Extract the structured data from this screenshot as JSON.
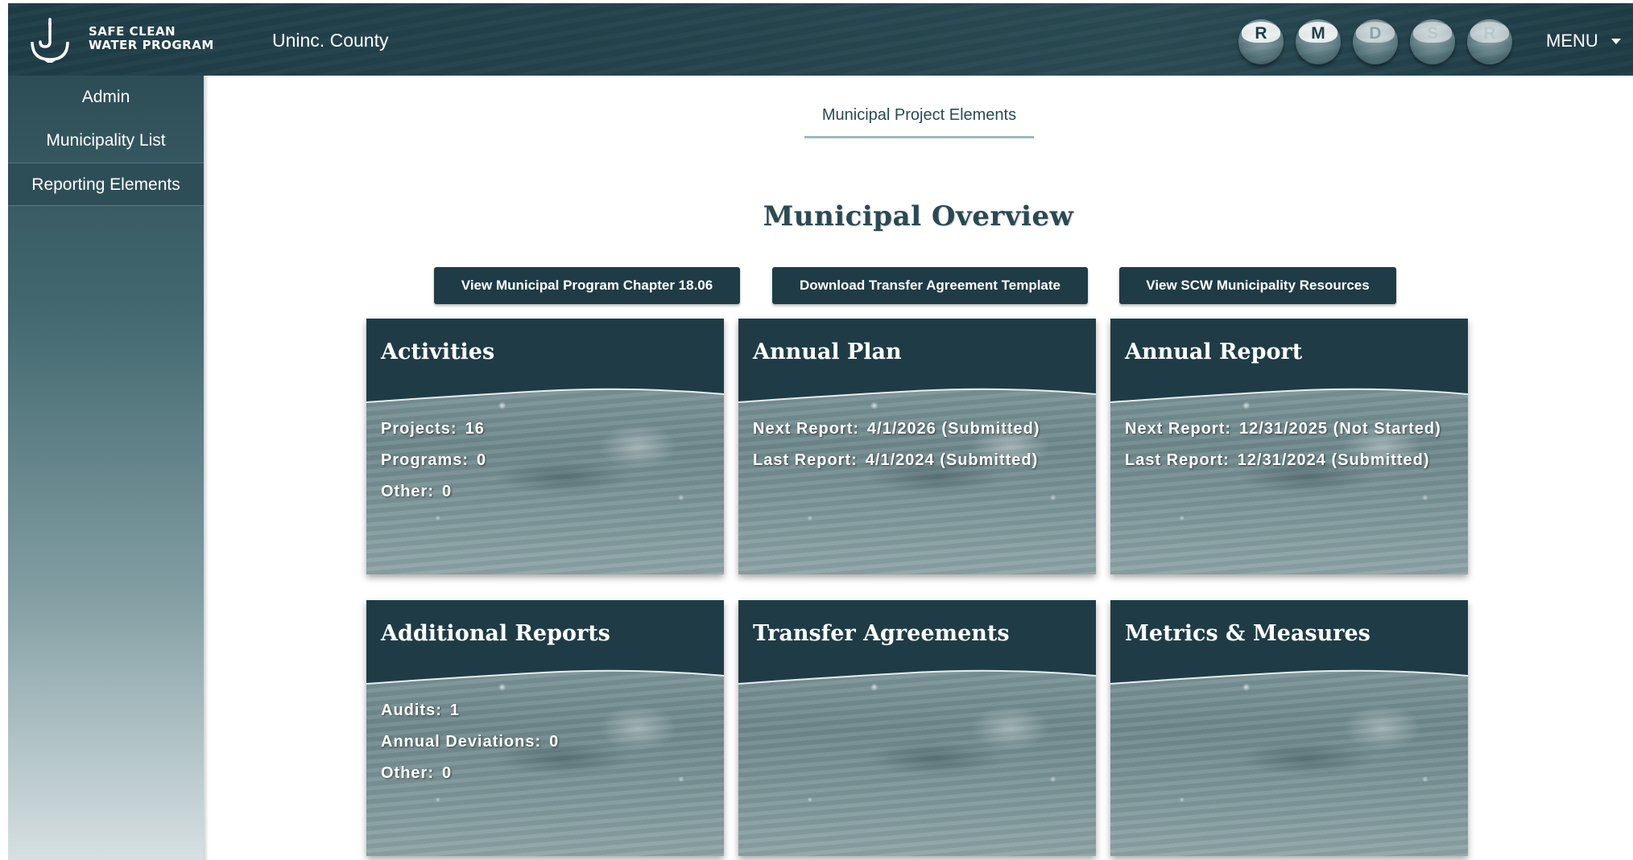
{
  "header": {
    "logo_text_line1": "SAFE CLEAN",
    "logo_text_line2": "WATER PROGRAM",
    "county": "Uninc. County",
    "badges": [
      "R",
      "M",
      "D",
      "S",
      "R"
    ],
    "menu_label": "MENU"
  },
  "sidebar": {
    "items": [
      {
        "label": "Admin"
      },
      {
        "label": "Municipality List"
      },
      {
        "label": "Reporting Elements"
      }
    ]
  },
  "main": {
    "tab": "Municipal Project Elements",
    "title": "Municipal Overview",
    "buttons": [
      {
        "label": "View Municipal Program Chapter 18.06"
      },
      {
        "label": "Download Transfer Agreement Template"
      },
      {
        "label": "View SCW Municipality Resources"
      }
    ],
    "cards": [
      {
        "title": "Activities",
        "rows": [
          {
            "k": "Projects:",
            "v": "16"
          },
          {
            "k": "Programs:",
            "v": "0"
          },
          {
            "k": "Other:",
            "v": "0"
          }
        ]
      },
      {
        "title": "Annual Plan",
        "rows": [
          {
            "k": "Next Report:",
            "v": "4/1/2026 (Submitted)"
          },
          {
            "k": "Last Report:",
            "v": "4/1/2024 (Submitted)"
          }
        ]
      },
      {
        "title": "Annual Report",
        "rows": [
          {
            "k": "Next Report:",
            "v": "12/31/2025 (Not Started)"
          },
          {
            "k": "Last Report:",
            "v": "12/31/2024 (Submitted)"
          }
        ]
      },
      {
        "title": "Additional Reports",
        "rows": [
          {
            "k": "Audits:",
            "v": "1"
          },
          {
            "k": "Annual Deviations:",
            "v": "0"
          },
          {
            "k": "Other:",
            "v": "0"
          }
        ]
      },
      {
        "title": "Transfer Agreements",
        "rows": []
      },
      {
        "title": "Metrics & Measures",
        "rows": []
      }
    ]
  },
  "colors": {
    "header_bg": "#1f3d47",
    "button_bg": "#1f3c46",
    "card_header": "#1f3c46",
    "title_text": "#2a4a53"
  },
  "icons": {
    "logo": "umbrella-drop-icon",
    "menu": "caret-down-icon"
  }
}
